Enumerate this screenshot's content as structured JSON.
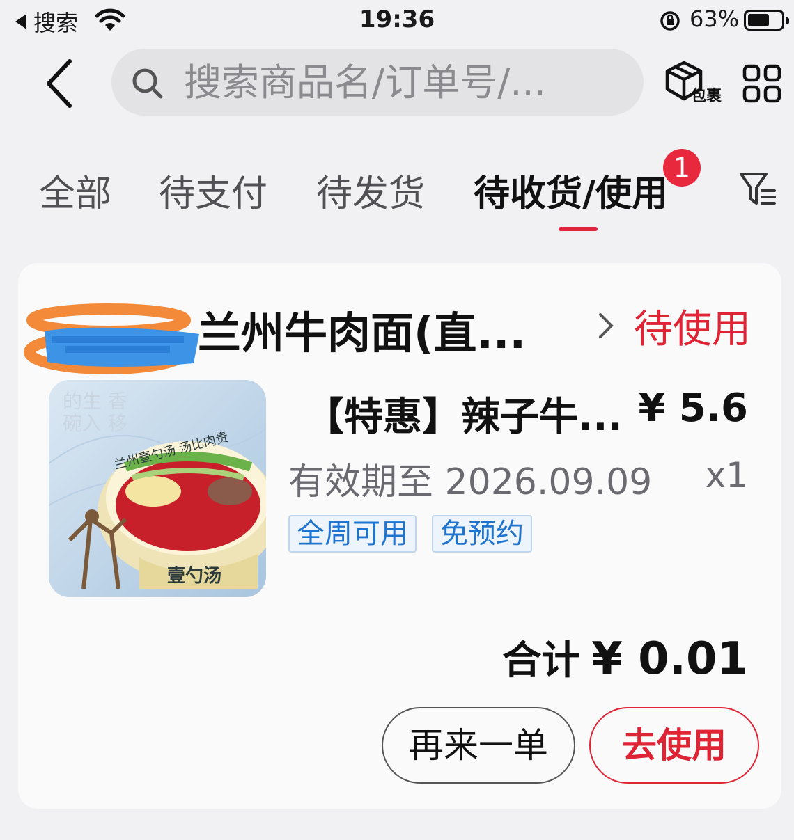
{
  "status_bar": {
    "back_app": "搜索",
    "time": "19:36",
    "battery": "63%"
  },
  "header": {
    "search_placeholder": "搜索商品名/订单号/...",
    "package_label": "包裹"
  },
  "tabs": [
    {
      "label": "全部",
      "active": false
    },
    {
      "label": "待支付",
      "active": false
    },
    {
      "label": "待发货",
      "active": false
    },
    {
      "label": "待收货/使用",
      "active": true,
      "badge": "1"
    }
  ],
  "order": {
    "shop_name": "兰州牛肉面(直...",
    "status": "待使用",
    "product_title": "【特惠】辣子牛...",
    "price": "¥ 5.6",
    "expiry": "有效期至 2026.09.09",
    "quantity": "x1",
    "tags": [
      "全周可用",
      "免预约"
    ],
    "total_label": "合计",
    "total_amount": "¥ 0.01",
    "thumb_text": [
      "壹勺汤",
      "兰州壹勺汤 汤比肉贵"
    ]
  },
  "actions": {
    "reorder": "再来一单",
    "use": "去使用"
  },
  "colors": {
    "accent_red": "#df2535",
    "tag_blue": "#1f74cf",
    "background": "#f1f1f3"
  }
}
